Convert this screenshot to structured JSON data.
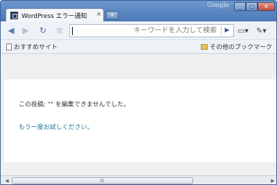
{
  "window": {
    "brand": "Google",
    "controls": {
      "minimize": "_",
      "maximize": "□",
      "close": "✕"
    }
  },
  "tab": {
    "title": "WordPress エラー通知",
    "close": "×",
    "new_tab": "+"
  },
  "toolbar": {
    "back_icon": "◀",
    "forward_icon": "▶",
    "reload_icon": "↻",
    "star_icon": "☆",
    "omnibox_placeholder": "キーワードを入力して検索",
    "go_icon": "▶",
    "page_menu_icon": "▭▾",
    "wrench_menu_icon": "✎▾"
  },
  "bookmarks": {
    "left_label": "おすすめサイト",
    "right_label": "その他のブックマーク"
  },
  "page": {
    "message": "この投稿: \"\" を編集できませんでした。",
    "retry_link": "もう一度お試しください。"
  },
  "scrollbar": {
    "left_arrow": "◀",
    "right_arrow": "▶",
    "grip": "III"
  }
}
